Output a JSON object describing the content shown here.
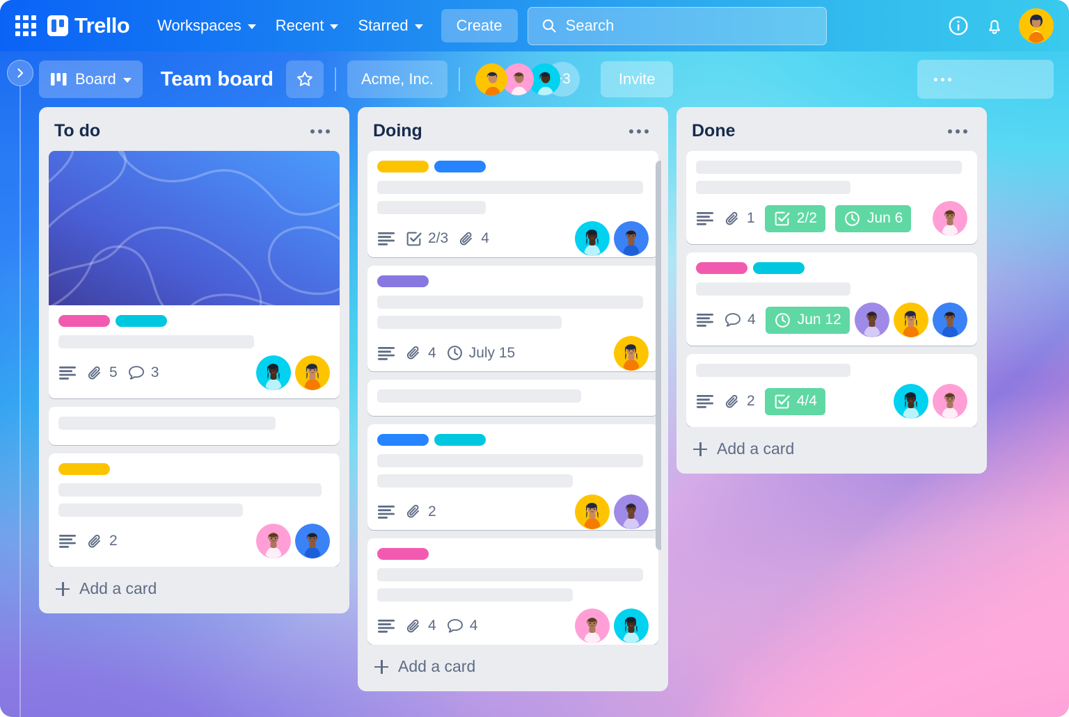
{
  "topnav": {
    "apps_icon": "grid-apps-icon",
    "brand": "Trello",
    "menus": [
      {
        "label": "Workspaces",
        "icon": "chevron-down-icon"
      },
      {
        "label": "Recent",
        "icon": "chevron-down-icon"
      },
      {
        "label": "Starred",
        "icon": "chevron-down-icon"
      }
    ],
    "create_label": "Create",
    "search": {
      "placeholder": "Search",
      "icon": "search-icon",
      "value": ""
    },
    "info_icon": "info-circle-icon",
    "bell_icon": "notification-bell-icon",
    "account_avatar": "user-avatar"
  },
  "boardbar": {
    "sidebar_toggle_icon": "chevron-right-icon",
    "view_label": "Board",
    "view_icon": "board-view-icon",
    "view_chevron": "chevron-down-icon",
    "title": "Team board",
    "star_icon": "star-outline-icon",
    "workspace": "Acme, Inc.",
    "extra_members": "+3",
    "invite_label": "Invite",
    "overflow_icon": "ellipsis-icon"
  },
  "colors": {
    "label_pink": "#f25ab0",
    "label_cyan": "#00c7e0",
    "label_yellow": "#fcc400",
    "label_blue": "#2684ff",
    "label_purple": "#8777e0",
    "badge_green": "#5fd8a4",
    "list_bg": "#ebecf0",
    "card_bg": "#ffffff",
    "text_dark": "#172b4d",
    "text_muted": "#5e6c84",
    "nav_blue": "#0b63f6",
    "nav_cyan": "#39caee"
  },
  "lists": [
    {
      "title": "To do",
      "menu_icon": "ellipsis-icon",
      "add_card_label": "Add a card",
      "cards": [
        {
          "has_cover": true,
          "cover_type": "blue-gradient-waves",
          "labels": [
            "label_pink",
            "label_cyan"
          ],
          "skeleton_lines": [
            72
          ],
          "badges": [
            {
              "type": "description",
              "icon": "description-icon",
              "text": ""
            },
            {
              "type": "attachment",
              "icon": "paperclip-icon",
              "text": "5"
            },
            {
              "type": "comment",
              "icon": "comment-icon",
              "text": "3"
            }
          ],
          "avatars": [
            "cyan",
            "yellow"
          ]
        },
        {
          "has_cover": false,
          "labels": [],
          "skeleton_lines": [
            80
          ],
          "badges": [],
          "avatars": []
        },
        {
          "has_cover": false,
          "labels": [
            "label_yellow"
          ],
          "skeleton_lines": [
            97,
            68
          ],
          "badges": [
            {
              "type": "description",
              "icon": "description-icon",
              "text": ""
            },
            {
              "type": "attachment",
              "icon": "paperclip-icon",
              "text": "2"
            }
          ],
          "avatars": [
            "pink",
            "blue"
          ]
        }
      ]
    },
    {
      "title": "Doing",
      "menu_icon": "ellipsis-icon",
      "add_card_label": "Add a card",
      "has_scrollbar": true,
      "cards": [
        {
          "has_cover": false,
          "labels": [
            "label_yellow",
            "label_blue"
          ],
          "skeleton_lines": [
            98,
            40
          ],
          "badges": [
            {
              "type": "description",
              "icon": "description-icon",
              "text": ""
            },
            {
              "type": "checklist",
              "icon": "checklist-icon",
              "text": "2/3"
            },
            {
              "type": "attachment",
              "icon": "paperclip-icon",
              "text": "4"
            }
          ],
          "avatars": [
            "cyan",
            "blue"
          ]
        },
        {
          "has_cover": false,
          "labels": [
            "label_purple"
          ],
          "skeleton_lines": [
            98,
            68
          ],
          "badges": [
            {
              "type": "description",
              "icon": "description-icon",
              "text": ""
            },
            {
              "type": "attachment",
              "icon": "paperclip-icon",
              "text": "4"
            },
            {
              "type": "due-date",
              "icon": "clock-icon",
              "text": "July 15"
            }
          ],
          "avatars": [
            "yellow"
          ]
        },
        {
          "has_cover": false,
          "labels": [],
          "skeleton_lines": [
            75
          ],
          "badges": [],
          "avatars": []
        },
        {
          "has_cover": false,
          "labels": [
            "label_blue",
            "label_cyan"
          ],
          "skeleton_lines": [
            98,
            72
          ],
          "badges": [
            {
              "type": "description",
              "icon": "description-icon",
              "text": ""
            },
            {
              "type": "attachment",
              "icon": "paperclip-icon",
              "text": "2"
            }
          ],
          "avatars": [
            "yellow",
            "purple"
          ]
        },
        {
          "has_cover": false,
          "labels": [
            "label_pink"
          ],
          "skeleton_lines": [
            98,
            72
          ],
          "badges": [
            {
              "type": "description",
              "icon": "description-icon",
              "text": ""
            },
            {
              "type": "attachment",
              "icon": "paperclip-icon",
              "text": "4"
            },
            {
              "type": "comment",
              "icon": "comment-icon",
              "text": "4"
            }
          ],
          "avatars": [
            "pink",
            "cyan"
          ]
        }
      ]
    },
    {
      "title": "Done",
      "menu_icon": "ellipsis-icon",
      "add_card_label": "Add a card",
      "cards": [
        {
          "has_cover": false,
          "labels": [],
          "skeleton_lines": [
            98,
            57
          ],
          "badges": [
            {
              "type": "description",
              "icon": "description-icon",
              "text": ""
            },
            {
              "type": "attachment",
              "icon": "paperclip-icon",
              "text": "1"
            },
            {
              "type": "checklist-complete",
              "icon": "checklist-icon",
              "text": "2/2"
            },
            {
              "type": "due-date-complete",
              "icon": "clock-icon",
              "text": "Jun 6"
            }
          ],
          "avatars": [
            "pink"
          ]
        },
        {
          "has_cover": false,
          "labels": [
            "label_pink",
            "label_cyan"
          ],
          "skeleton_lines": [
            57
          ],
          "badges": [
            {
              "type": "description",
              "icon": "description-icon",
              "text": ""
            },
            {
              "type": "comment",
              "icon": "comment-icon",
              "text": "4"
            },
            {
              "type": "due-date-complete",
              "icon": "clock-icon",
              "text": "Jun 12"
            }
          ],
          "avatars": [
            "purple",
            "yellow",
            "blue"
          ]
        },
        {
          "has_cover": false,
          "labels": [],
          "skeleton_lines": [
            57
          ],
          "badges": [
            {
              "type": "description",
              "icon": "description-icon",
              "text": ""
            },
            {
              "type": "attachment",
              "icon": "paperclip-icon",
              "text": "2"
            },
            {
              "type": "checklist-complete",
              "icon": "checklist-icon",
              "text": "4/4"
            }
          ],
          "avatars": [
            "cyan",
            "pink"
          ]
        }
      ]
    }
  ]
}
